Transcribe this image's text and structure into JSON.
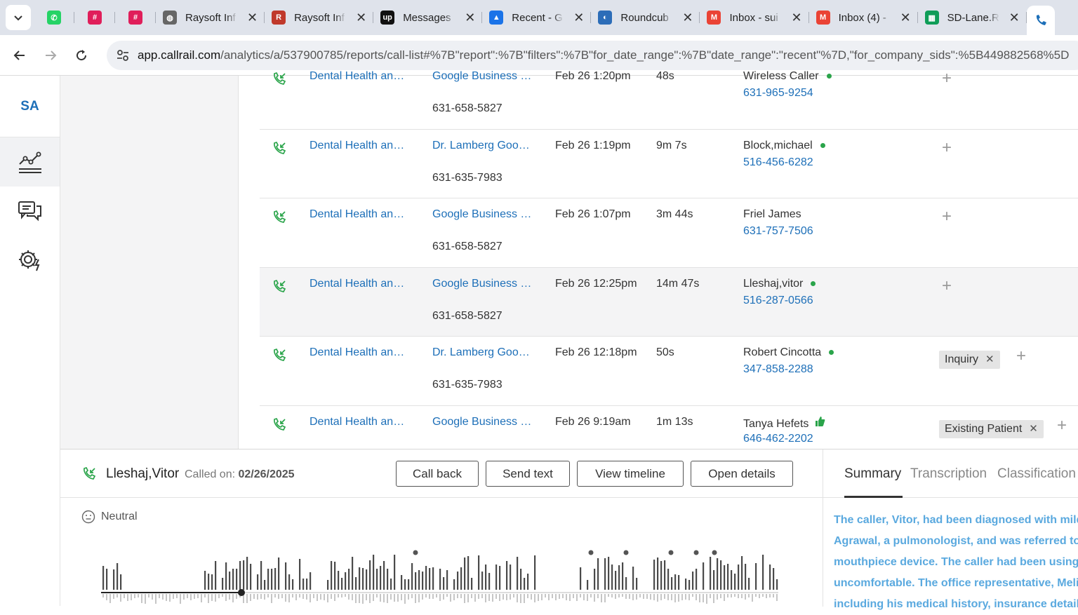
{
  "browser": {
    "tabs": [
      {
        "title": "",
        "icon": "whatsapp-icon",
        "color": "#25d366"
      },
      {
        "title": "",
        "icon": "slack-icon",
        "color": "#e01e5a"
      },
      {
        "title": "",
        "icon": "slack-icon",
        "color": "#e01e5a"
      },
      {
        "title": "Raysoft Inf",
        "icon": "globe-icon",
        "color": "#666666"
      },
      {
        "title": "Raysoft Inf",
        "icon": "raysoft-icon",
        "color": "#c0392b"
      },
      {
        "title": "Messages",
        "icon": "upwork-icon",
        "color": "#111111"
      },
      {
        "title": "Recent - G",
        "icon": "drive-icon",
        "color": "#1a73e8"
      },
      {
        "title": "Roundcub",
        "icon": "roundcube-icon",
        "color": "#2c6db8"
      },
      {
        "title": "Inbox - sui",
        "icon": "gmail-icon",
        "color": "#ea4335"
      },
      {
        "title": "Inbox (4) -",
        "icon": "gmail-icon",
        "color": "#ea4335"
      },
      {
        "title": "SD-Lane.R",
        "icon": "sheets-icon",
        "color": "#0f9d58"
      }
    ],
    "url_host": "app.callrail.com",
    "url_path": "/analytics/a/537900785/reports/call-list#%7B\"report\":%7B\"filters\":%7B\"for_date_range\":%7B\"date_range\":\"recent\"%7D,\"for_company_sids\":%5B449882568%5D"
  },
  "rail": {
    "logo": "SA",
    "items": [
      "analytics-icon",
      "conversations-icon",
      "settings-icon"
    ]
  },
  "calls": [
    {
      "company": "Dental Health an…",
      "source": "Google Business …",
      "tracking": "631-658-5827",
      "date": "Feb 26 1:20pm",
      "duration": "48s",
      "caller": "Wireless Caller",
      "caller_dot": true,
      "phone": "631-965-9254",
      "tags": []
    },
    {
      "company": "Dental Health an…",
      "source": "Dr. Lamberg Goo…",
      "tracking": "631-635-7983",
      "date": "Feb 26 1:19pm",
      "duration": "9m 7s",
      "caller": "Block,michael",
      "caller_dot": true,
      "phone": "516-456-6282",
      "tags": []
    },
    {
      "company": "Dental Health an…",
      "source": "Google Business …",
      "tracking": "631-658-5827",
      "date": "Feb 26 1:07pm",
      "duration": "3m 44s",
      "caller": "Friel James",
      "caller_dot": false,
      "phone": "631-757-7506",
      "tags": []
    },
    {
      "company": "Dental Health an…",
      "source": "Google Business …",
      "tracking": "631-658-5827",
      "date": "Feb 26 12:25pm",
      "duration": "14m 47s",
      "caller": "Lleshaj,vitor",
      "caller_dot": true,
      "phone": "516-287-0566",
      "tags": [],
      "highlighted": true
    },
    {
      "company": "Dental Health an…",
      "source": "Dr. Lamberg Goo…",
      "tracking": "631-635-7983",
      "date": "Feb 26 12:18pm",
      "duration": "50s",
      "caller": "Robert Cincotta",
      "caller_dot": true,
      "phone": "347-858-2288",
      "tags": [
        "Inquiry"
      ]
    },
    {
      "company": "Dental Health an…",
      "source": "Google Business …",
      "tracking": "",
      "date": "Feb 26 9:19am",
      "duration": "1m 13s",
      "caller": "Tanya Hefets",
      "caller_dot": false,
      "thumbs_up": true,
      "phone": "646-462-2202",
      "tags": [
        "Existing Patient"
      ]
    }
  ],
  "panel": {
    "caller_name": "Lleshaj,Vitor",
    "called_on_label": "Called on:",
    "called_on_date": "02/26/2025",
    "buttons": {
      "call_back": "Call back",
      "send_text": "Send text",
      "view_timeline": "View timeline",
      "open_details": "Open details"
    },
    "sentiment": "Neutral",
    "side_tabs": [
      "Summary",
      "Transcription",
      "Classification"
    ],
    "summary_lines": [
      "The caller, Vitor, had been diagnosed with mild",
      "Agrawal, a pulmonologist, and was referred to",
      "mouthpiece device. The caller had been using a",
      "uncomfortable. The office representative, Meli",
      "including his medical history, insurance detail"
    ]
  },
  "colors": {
    "link": "#1d6fb8",
    "online_dot": "#2aa44a",
    "summary_text": "#5aa9df",
    "call_icon": "#2aa44a"
  }
}
